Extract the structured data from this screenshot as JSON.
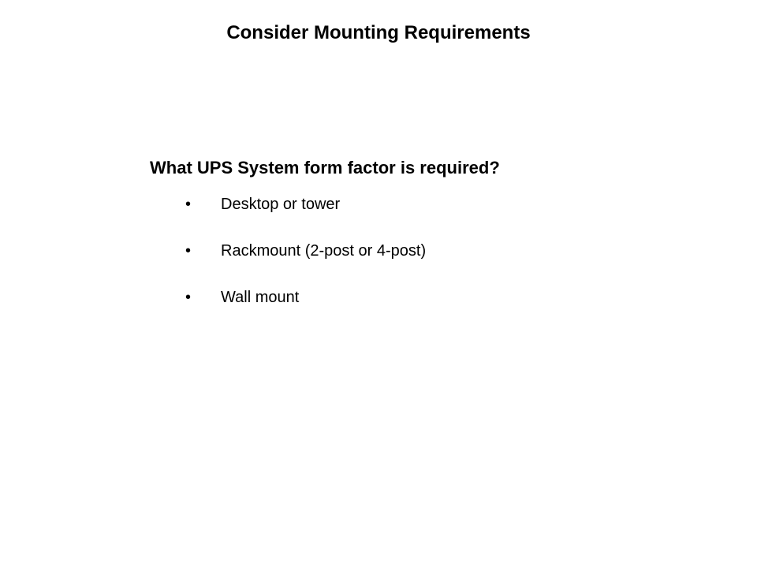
{
  "title": "Consider Mounting Requirements",
  "subtitle": "What UPS System form factor is required?",
  "bullets": [
    "Desktop or tower",
    "Rackmount (2-post or 4-post)",
    "Wall mount"
  ]
}
